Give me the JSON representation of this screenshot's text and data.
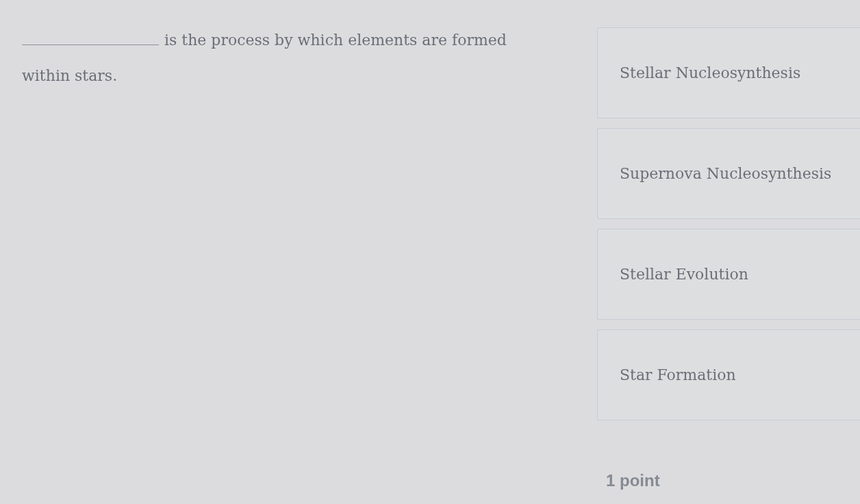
{
  "question": {
    "text": "is the process by which elements are formed within stars."
  },
  "options": [
    {
      "label": "Stellar Nucleosynthesis",
      "selected": false
    },
    {
      "label": "Supernova Nucleosynthesis",
      "selected": false
    },
    {
      "label": "Stellar Evolution",
      "selected": false
    },
    {
      "label": "Star Formation",
      "selected": false
    }
  ],
  "points": "1 point"
}
